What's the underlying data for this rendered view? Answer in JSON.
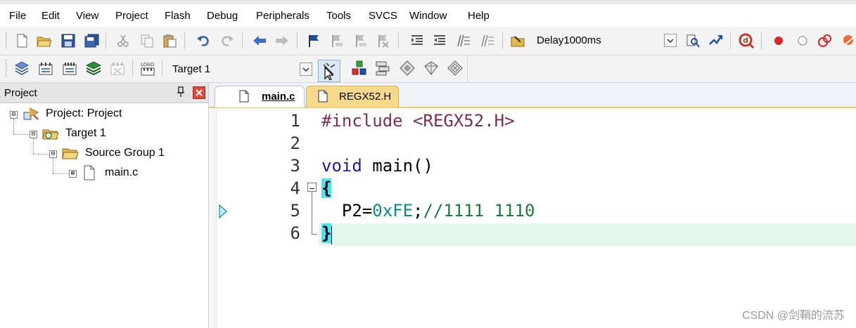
{
  "menu": [
    "File",
    "Edit",
    "View",
    "Project",
    "Flash",
    "Debug",
    "Peripherals",
    "Tools",
    "SVCS",
    "Window",
    "Help"
  ],
  "toolbar1": {
    "buttons": [
      "new-file-icon",
      "open-file-icon",
      "save-icon",
      "save-all-icon",
      "cut-icon",
      "copy-icon",
      "paste-icon",
      "undo-icon",
      "redo-icon",
      "nav-back-icon",
      "nav-forward-icon",
      "bookmark-icon",
      "prev-bookmark-icon",
      "next-bookmark-icon",
      "clear-bookmarks-icon",
      "indent-icon",
      "unindent-icon",
      "comment-icon",
      "uncomment-icon",
      "find-in-files-icon"
    ],
    "find_combo": "Delay1000ms",
    "right_buttons": [
      "find-icon",
      "incremental-find-icon",
      "debug-session-icon",
      "breakpoint-icon",
      "disable-breakpoint-icon",
      "kill-breakpoints-icon"
    ]
  },
  "toolbar2": {
    "buttons": [
      "translate-icon",
      "build-icon",
      "rebuild-icon",
      "batch-build-icon",
      "stop-build-icon",
      "download-icon"
    ],
    "target_combo": "Target 1",
    "right_buttons": [
      "target-options-icon",
      "manage-components-icon",
      "file-extensions-icon",
      "select-packs-icon",
      "manage-rte-icon",
      "books-icon"
    ]
  },
  "project": {
    "title": "Project",
    "pin_icon": "pin-icon",
    "close_icon": "close-icon",
    "tree": [
      {
        "label": "Project: Project",
        "icon": "project-icon",
        "expander": "⊟"
      },
      {
        "label": "Target 1",
        "icon": "target-folder-icon",
        "expander": "⊟"
      },
      {
        "label": "Source Group 1",
        "icon": "folder-icon",
        "expander": "⊟"
      },
      {
        "label": "main.c",
        "icon": "file-icon",
        "expander": "⊞"
      }
    ]
  },
  "tabs": [
    {
      "label": "main.c",
      "active": true
    },
    {
      "label": "REGX52.H",
      "active": false
    }
  ],
  "editor": {
    "line_numbers": [
      "1",
      "2",
      "3",
      "4",
      "5",
      "6"
    ],
    "lines": [
      {
        "parts": [
          {
            "text": "#include",
            "color": "#7b2f53"
          },
          {
            "text": " ",
            "color": "#000000"
          },
          {
            "text": "<REGX52.H>",
            "color": "#7b2f53"
          }
        ]
      },
      {
        "parts": []
      },
      {
        "parts": [
          {
            "text": "void",
            "color": "#1d1d99"
          },
          {
            "text": " main()",
            "color": "#000000"
          }
        ]
      },
      {
        "parts": [
          {
            "text": "{",
            "color": "#000000"
          }
        ]
      },
      {
        "parts": [
          {
            "text": "  P2=",
            "color": "#000000"
          },
          {
            "text": "0xFE",
            "color": "#0a8a8a"
          },
          {
            "text": ";",
            "color": "#000000"
          },
          {
            "text": "//1111 1110",
            "color": "#1c7a3a"
          }
        ]
      },
      {
        "parts": [
          {
            "text": "}",
            "color": "#000000"
          }
        ]
      }
    ]
  },
  "colors": {
    "brace_highlight": "#4de3f4",
    "current_line": "#e2f8ec",
    "active_tab_accent": "#f6d98a"
  },
  "watermark": "CSDN @剑鞘的流苏"
}
